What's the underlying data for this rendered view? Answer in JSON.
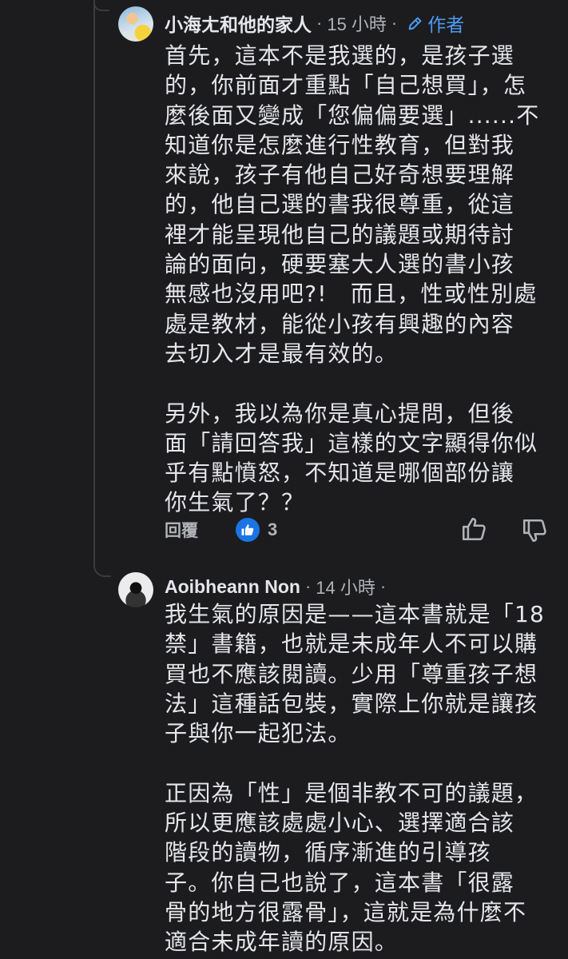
{
  "comments": [
    {
      "author": "小海ㄤ和他的家人",
      "separator": "·",
      "time": "15 小時",
      "more": "·",
      "badge_label": "作者",
      "text": "首先，這本不是我選的，是孩子選\n的，你前面才重點「自己想買」，怎\n麼後面又變成「您偏偏要選」......不\n知道你是怎麼進行性教育，但對我\n來說，孩子有他自己好奇想要理解\n的，他自己選的書我很尊重，從這\n裡才能呈現他自己的議題或期待討\n論的面向，硬要塞大人選的書小孩\n無感也沒用吧?!　而且，性或性別處\n處是教材，能從小孩有興趣的內容\n去切入才是最有效的。\n\n另外，我以為你是真心提問，但後\n面「請回答我」這樣的文字顯得你似\n乎有點憤怒，不知道是哪個部份讓\n你生氣了？？",
      "reply_label": "回覆",
      "reaction_count": "3"
    },
    {
      "author": "Aoibheann Non",
      "separator": "·",
      "time": "14 小時",
      "more": "·",
      "text": "我生氣的原因是——這本書就是「18\n禁」書籍，也就是未成年人不可以購\n買也不應該閱讀。少用「尊重孩子想\n法」這種話包裝，實際上你就是讓孩\n子與你一起犯法。\n\n正因為「性」是個非教不可的議題，\n所以更應該處處小心、選擇適合該\n階段的讀物，循序漸進的引導孩\n子。你自己也說了，這本書「很露\n骨的地方很露骨」，這就是為什麼不\n適合未成年讀的原因。"
    }
  ],
  "icons": {
    "badge": "pencil-icon",
    "reaction": "like-icon",
    "like_button": "thumb-up-icon",
    "dislike_button": "thumb-down-icon"
  },
  "colors": {
    "background": "#1c1c1e",
    "text": "#e4e6eb",
    "meta": "#b0b3b8",
    "accent": "#4a9bf6",
    "like": "#1b74e4"
  }
}
